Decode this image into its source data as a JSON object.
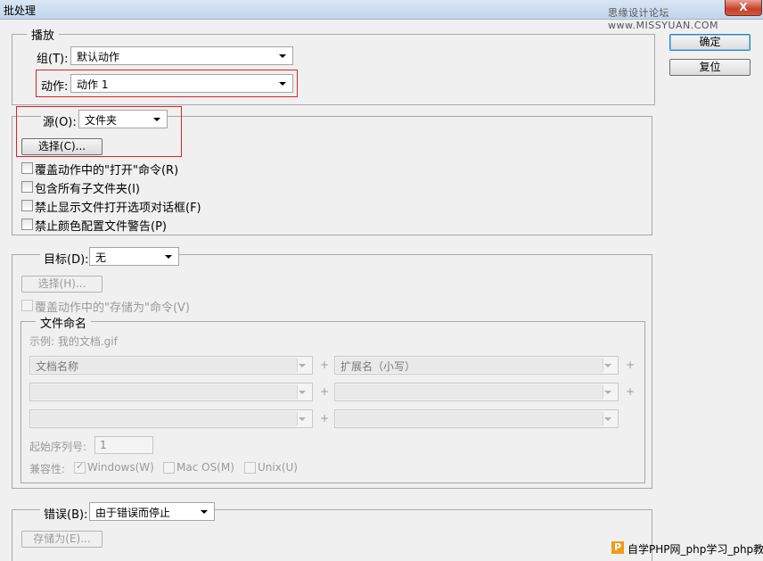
{
  "window": {
    "title": "批处理",
    "watermark": "思缘设计论坛 www.MISSYUAN.COM",
    "close_label": "X"
  },
  "side_buttons": {
    "ok": "确定",
    "reset": "复位"
  },
  "play": {
    "legend": "播放",
    "set_label": "组(T):",
    "set_value": "默认动作",
    "action_label": "动作:",
    "action_value": "动作 1"
  },
  "source": {
    "label": "源(O):",
    "value": "文件夹",
    "choose_button": "选择(C)...",
    "options": [
      {
        "label": "覆盖动作中的\"打开\"命令(R)",
        "checked": false
      },
      {
        "label": "包含所有子文件夹(I)",
        "checked": false
      },
      {
        "label": "禁止显示文件打开选项对话框(F)",
        "checked": false
      },
      {
        "label": "禁止颜色配置文件警告(P)",
        "checked": false
      }
    ]
  },
  "destination": {
    "label": "目标(D):",
    "value": "无",
    "choose_button": "选择(H)...",
    "override_save": "覆盖动作中的\"存储为\"命令(V)",
    "naming": {
      "legend": "文件命名",
      "example": "示例: 我的文档.gif",
      "fields": [
        [
          "文档名称",
          "扩展名（小写）"
        ],
        [
          "",
          ""
        ],
        [
          "",
          ""
        ]
      ],
      "plus": "+",
      "start_serial_label": "起始序列号:",
      "start_serial_value": "1",
      "compat_label": "兼容性:",
      "compat": [
        {
          "label": "Windows(W)",
          "checked": true
        },
        {
          "label": "Mac OS(M)",
          "checked": false
        },
        {
          "label": "Unix(U)",
          "checked": false
        }
      ]
    }
  },
  "errors": {
    "label": "错误(B):",
    "value": "由于错误而停止",
    "save_button": "存储为(E)..."
  },
  "footer": {
    "logo": "P",
    "text": "自学PHP网_php学习_php教"
  }
}
